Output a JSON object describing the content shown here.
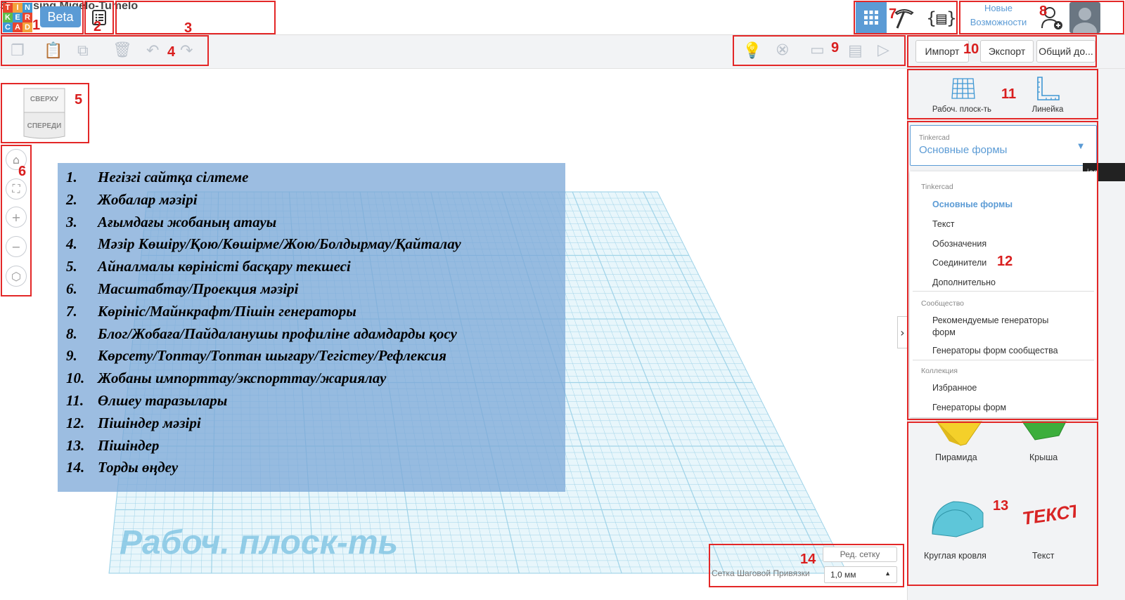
{
  "app": {
    "logo_letters": [
      "T",
      "I",
      "N",
      "K",
      "E",
      "R",
      "C",
      "A",
      "D"
    ],
    "beta_label": "Beta",
    "project_title": "Surprising Migelo-Tumelo",
    "whats_new_line1": "Новые",
    "whats_new_line2": "Возможности"
  },
  "toolbar": {
    "import_label": "Импорт",
    "export_label": "Экспорт",
    "share_label": "Общий до..."
  },
  "viewcube": {
    "top": "СВЕРХУ",
    "front": "СПЕРЕДИ"
  },
  "workplane_tools": {
    "workplane_label": "Рабоч. плоск-ть",
    "ruler_label": "Линейка"
  },
  "shapes_dropdown": {
    "source_label": "Tinkercad",
    "selected": "Основные формы",
    "groups": [
      {
        "title": "Tinkercad",
        "items": [
          "Основные формы",
          "Текст",
          "Обозначения",
          "Соединители",
          "Дополнительно"
        ]
      },
      {
        "title": "Сообщество",
        "items": [
          "Рекомендуемые генераторы форм",
          "Генераторы форм сообщества"
        ]
      },
      {
        "title": "Коллекция",
        "items": [
          "Избранное",
          "Генераторы форм"
        ]
      }
    ]
  },
  "tooltip_fragment": "ico",
  "shapes": [
    "Пирамида",
    "Крыша",
    "Круглая кровля",
    "Текст"
  ],
  "text_shape_art": "ТЕКСТ",
  "workplane_watermark": "Рабоч. плоск-ть",
  "grid_settings": {
    "edit_grid_label": "Ред. сетку",
    "snap_label": "Сетка Шаговой Привязки",
    "snap_value": "1,0 мм"
  },
  "legend": [
    "Негізгі сайтқа сілтеме",
    "Жобалар мәзірі",
    "Ағымдағы жобаның атауы",
    "Мәзір Көшіру/Қою/Көшірме/Жою/Болдырмау/Қайталау",
    "Айналмалы көріністі басқару текшесі",
    "Масштабтау/Проекция мәзірі",
    "Көрініс/Майнкрафт/Пішін генераторы",
    "Блог/Жобаға/Пайдаланушы профиліне адамдарды қосу",
    "Көрсету/Топтау/Топтан шығару/Тегістеу/Рефлексия",
    "Жобаны импорттау/экспорттау/жариялау",
    "Өлшеу таразылары",
    "Пішіндер мәзірі",
    "Пішіндер",
    "Торды өңдеу"
  ],
  "legend_numbers": [
    "1.",
    "2.",
    "3.",
    "4.",
    "5.",
    "6.",
    "7.",
    "8.",
    "9.",
    "10.",
    "11.",
    "12.",
    "13.",
    "14."
  ],
  "callouts": [
    "1",
    "2",
    "3",
    "4",
    "5",
    "6",
    "7",
    "8",
    "9",
    "10",
    "11",
    "12",
    "13",
    "14"
  ],
  "colors": {
    "logo": [
      "#e8452d",
      "#f4a13b",
      "#3f97d3",
      "#5ebb4a",
      "#3f97d3",
      "#e8452d",
      "#3f97d3",
      "#e8452d",
      "#f4a13b"
    ],
    "accent": "#5b9bd5",
    "callout_red": "#e32727",
    "grid": "#9fd3e8"
  }
}
